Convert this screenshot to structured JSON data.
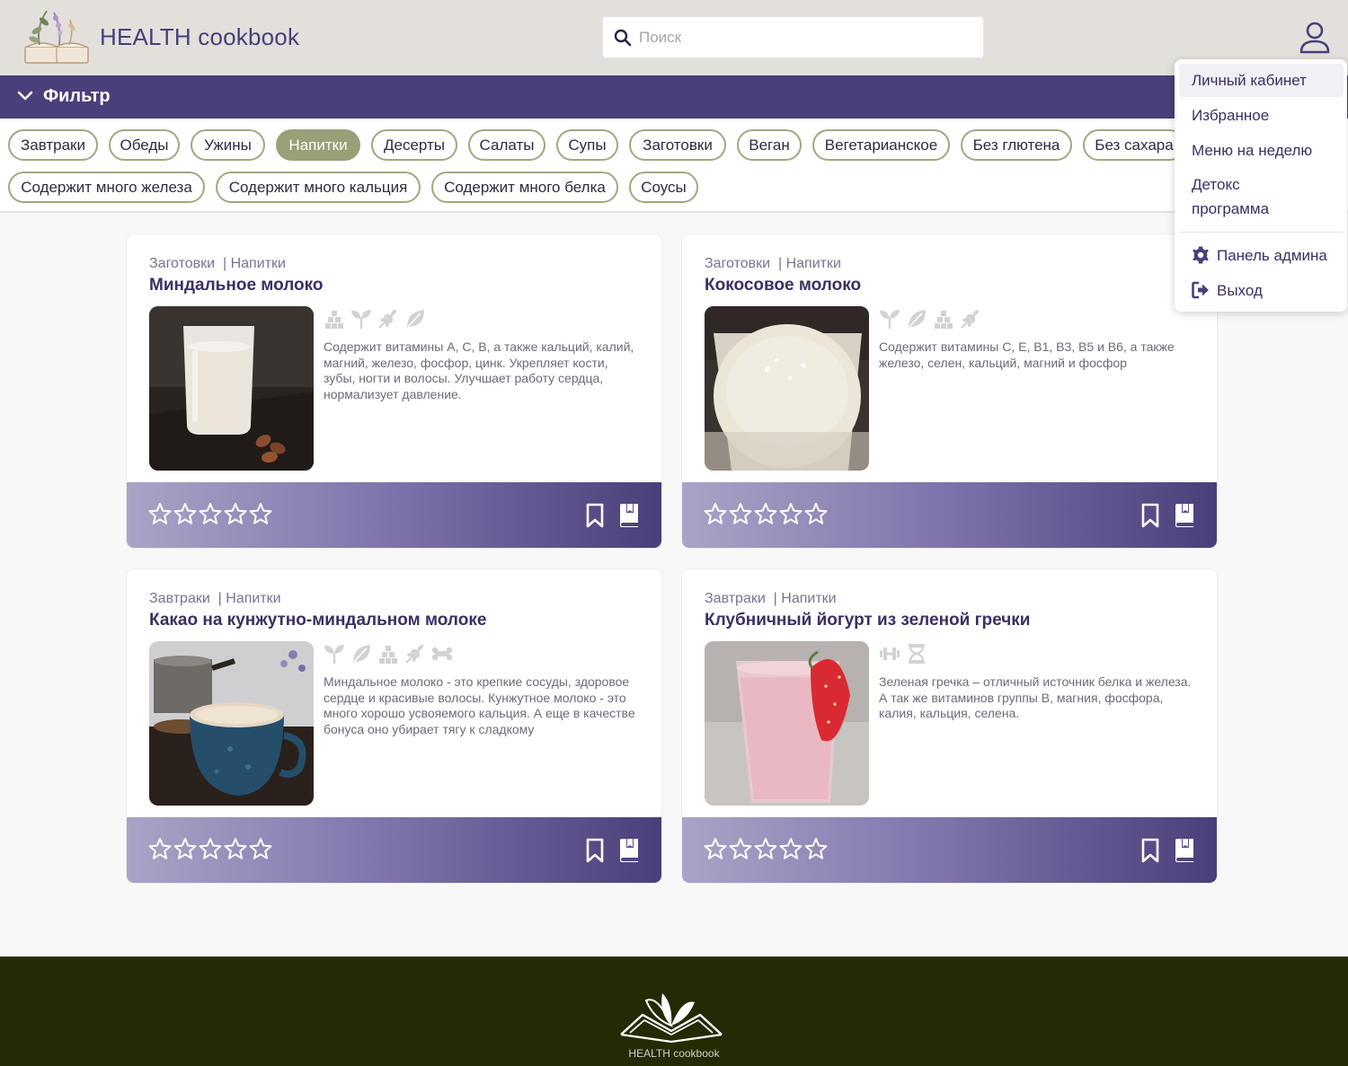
{
  "header": {
    "brand": "HEALTH cookbook",
    "search_placeholder": "Поиск",
    "search_value": ""
  },
  "filter": {
    "label": "Фильтр",
    "chips": [
      "Завтраки",
      "Обеды",
      "Ужины",
      "Напитки",
      "Десерты",
      "Салаты",
      "Супы",
      "Заготовки",
      "Веган",
      "Вегетарианское",
      "Без глютена",
      "Без сахара",
      "Содержит много железа",
      "Содержит много кальция",
      "Содержит много белка",
      "Соусы"
    ],
    "active": "Напитки"
  },
  "cards": [
    {
      "cat1": "Заготовки",
      "sep": "|",
      "cat2": "Напитки",
      "title": "Миндальное молоко",
      "desc": "Содержит витамины A, C, B, а также кальций, калий, магний, железо, фосфор, цинк. Укрепляет кости, зубы, ногти и волосы. Улучшает работу сердца, нормализует давление.",
      "tags": [
        "cubes-icon",
        "sprout-icon",
        "wheat-icon",
        "leaf-icon"
      ],
      "rating": 0
    },
    {
      "cat1": "Заготовки",
      "sep": "|",
      "cat2": "Напитки",
      "title": "Кокосовое молоко",
      "desc": "Содержит витамины C, E, B1, B3, B5 и B6, а также железо, селен, кальций, магний и фосфор",
      "tags": [
        "sprout-icon",
        "leaf-icon",
        "cubes-icon",
        "wheat-icon"
      ],
      "rating": 0
    },
    {
      "cat1": "Завтраки",
      "sep": "|",
      "cat2": "Напитки",
      "title": "Какао на кунжутно-миндальном молоке",
      "desc": "Миндальное молоко - это крепкие сосуды, здоровое сердце и красивые волосы.    Кунжутное молоко - это много хорошо усвояемого кальция. А еще в качестве бонуса оно убирает тягу к сладкому",
      "tags": [
        "sprout-icon",
        "leaf-icon",
        "cubes-icon",
        "wheat-icon",
        "bone-icon"
      ],
      "rating": 0
    },
    {
      "cat1": "Завтраки",
      "sep": "|",
      "cat2": "Напитки",
      "title": "Клубничный йогурт из зеленой гречки",
      "desc": "Зеленая гречка – отличный источник белка и железа. А так же витаминов группы B, магния, фосфора, калия, кальция, селена.",
      "tags": [
        "dumbbell-icon",
        "hourglass-icon"
      ],
      "rating": 0
    }
  ],
  "user_menu": {
    "items": [
      "Личный кабинет",
      "Избранное",
      "Меню на неделю",
      "Детокс программа"
    ],
    "admin": "Панель админа",
    "logout": "Выход"
  },
  "footer": {
    "brand": "HEALTH cookbook"
  },
  "colors": {
    "brand_purple": "#4a3f7a",
    "chip_border": "#a3a77f",
    "chip_active": "#9b9f78",
    "footer_bg": "#252a05"
  }
}
